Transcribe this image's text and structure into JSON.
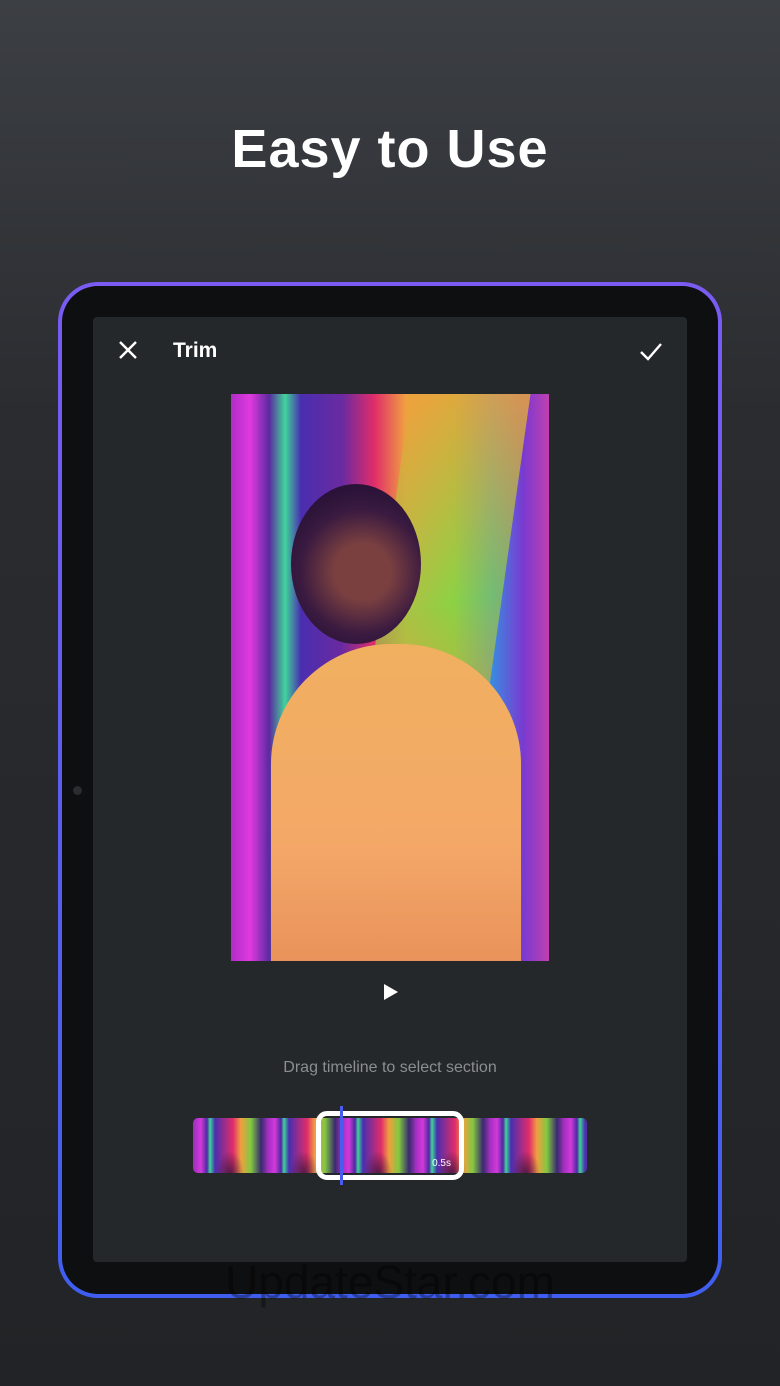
{
  "headline": "Easy to Use",
  "editor": {
    "title": "Trim",
    "hint": "Drag timeline to select section",
    "selection_duration": "0.5s"
  },
  "icons": {
    "close": "close-icon",
    "confirm": "check-icon",
    "play": "play-icon"
  },
  "colors": {
    "accent": "#4a5cf0",
    "frame_top": "#7a5cf2",
    "frame_bottom": "#3f5ef0"
  },
  "watermark": "UpdateStar.com"
}
